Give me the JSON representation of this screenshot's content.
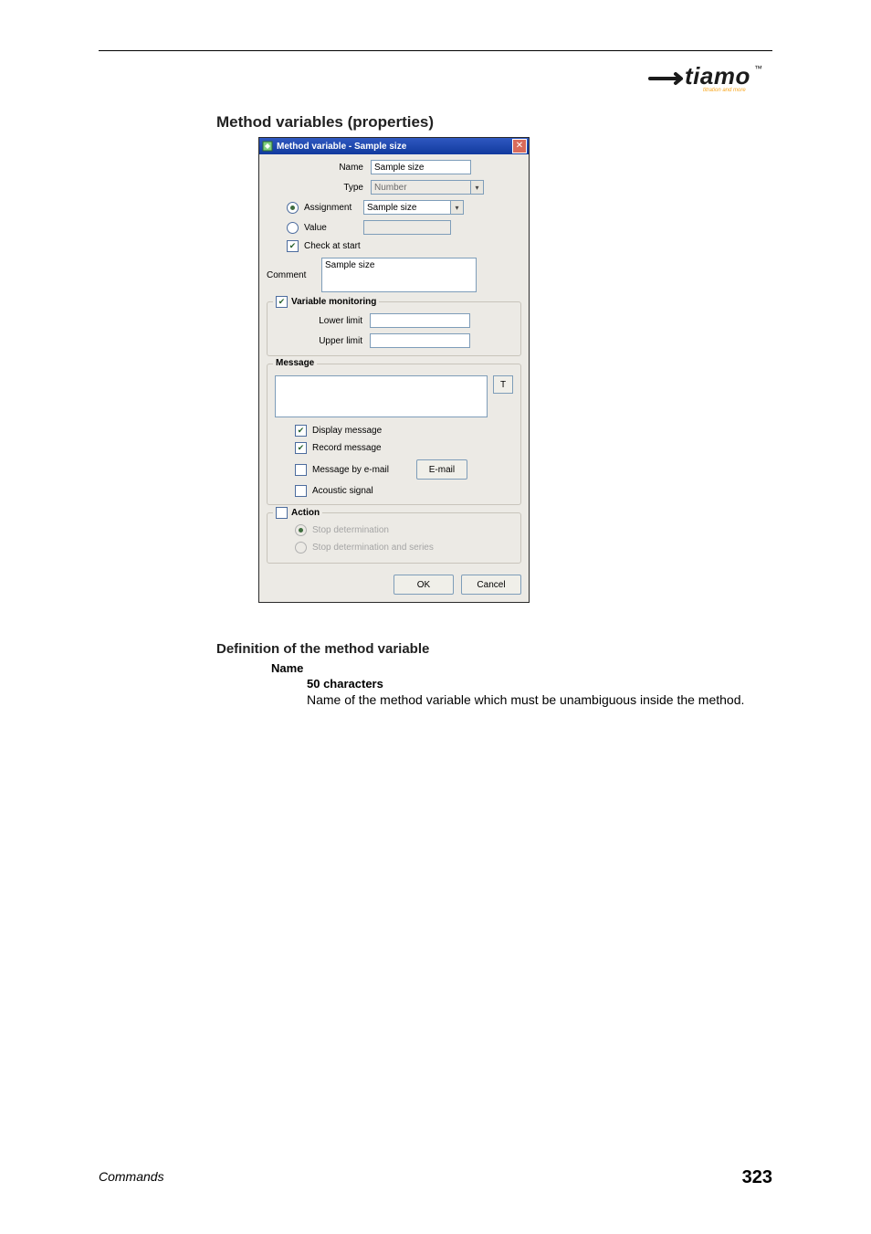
{
  "page": {
    "footer_left": "Commands",
    "footer_right": "323"
  },
  "logo": {
    "text": "tiamo",
    "tm": "™",
    "tagline": "titration and more"
  },
  "headings": {
    "h1": "Method variables (properties)",
    "h2": "Definition of the method variable"
  },
  "dialog": {
    "title": "Method variable - Sample size",
    "labels": {
      "name": "Name",
      "type": "Type",
      "assignment": "Assignment",
      "value": "Value",
      "check_at_start": "Check at start",
      "comment": "Comment",
      "variable_monitoring": "Variable monitoring",
      "lower_limit": "Lower limit",
      "upper_limit": "Upper limit",
      "message": "Message",
      "display_message": "Display message",
      "record_message": "Record message",
      "message_by_email": "Message by e-mail",
      "email_btn": "E-mail",
      "acoustic_signal": "Acoustic signal",
      "action": "Action",
      "stop_determination": "Stop determination",
      "stop_determination_series": "Stop determination and series",
      "t_btn": "T",
      "ok": "OK",
      "cancel": "Cancel"
    },
    "values": {
      "name": "Sample size",
      "type": "Number",
      "assignment": "Sample size",
      "value": "",
      "comment": "Sample size",
      "lower_limit": "",
      "upper_limit": ""
    }
  },
  "definition": {
    "name_label": "Name",
    "constraint": "50 characters",
    "text": "Name of the method variable which must be unambiguous inside the method."
  }
}
